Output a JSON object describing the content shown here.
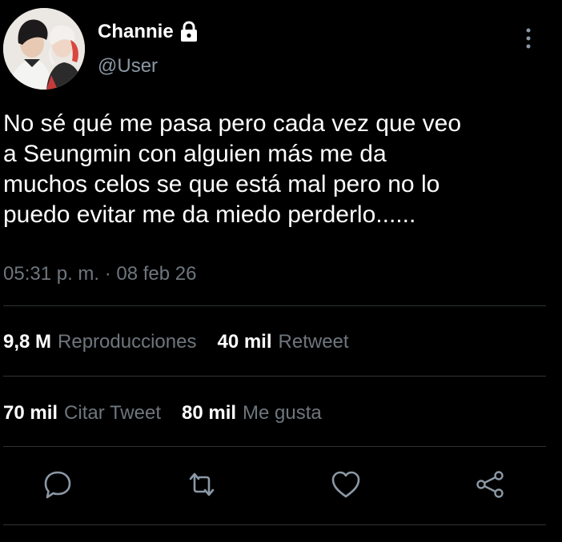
{
  "author": {
    "display_name": "Channie",
    "handle": "@User",
    "lock_icon": "lock-icon",
    "avatar": "profile-photo"
  },
  "tweet": {
    "text": "No sé qué me pasa pero cada vez que veo\na Seungmin con alguien más me  da\nmuchos celos se que está mal pero no lo\npuedo evitar me da miedo perderlo......",
    "timestamp": "05:31 p. m. · 08 feb 26"
  },
  "stats": {
    "views_count": "9,8 M",
    "views_label": "Reproducciones",
    "retweets_count": "40 mil",
    "retweets_label": "Retweet",
    "quotes_count": "70 mil",
    "quotes_label": "Citar Tweet",
    "likes_count": "80 mil",
    "likes_label": "Me gusta"
  },
  "actions": {
    "reply_icon": "reply-icon",
    "retweet_icon": "retweet-icon",
    "like_icon": "heart-icon",
    "share_icon": "share-icon",
    "more_icon": "more-vertical-icon"
  },
  "colors": {
    "background": "#000000",
    "primary_text": "#ffffff",
    "secondary_text": "#6e767d",
    "handle_text": "#8b98a5",
    "divider": "#2f3336",
    "icon": "#8b98a5"
  }
}
